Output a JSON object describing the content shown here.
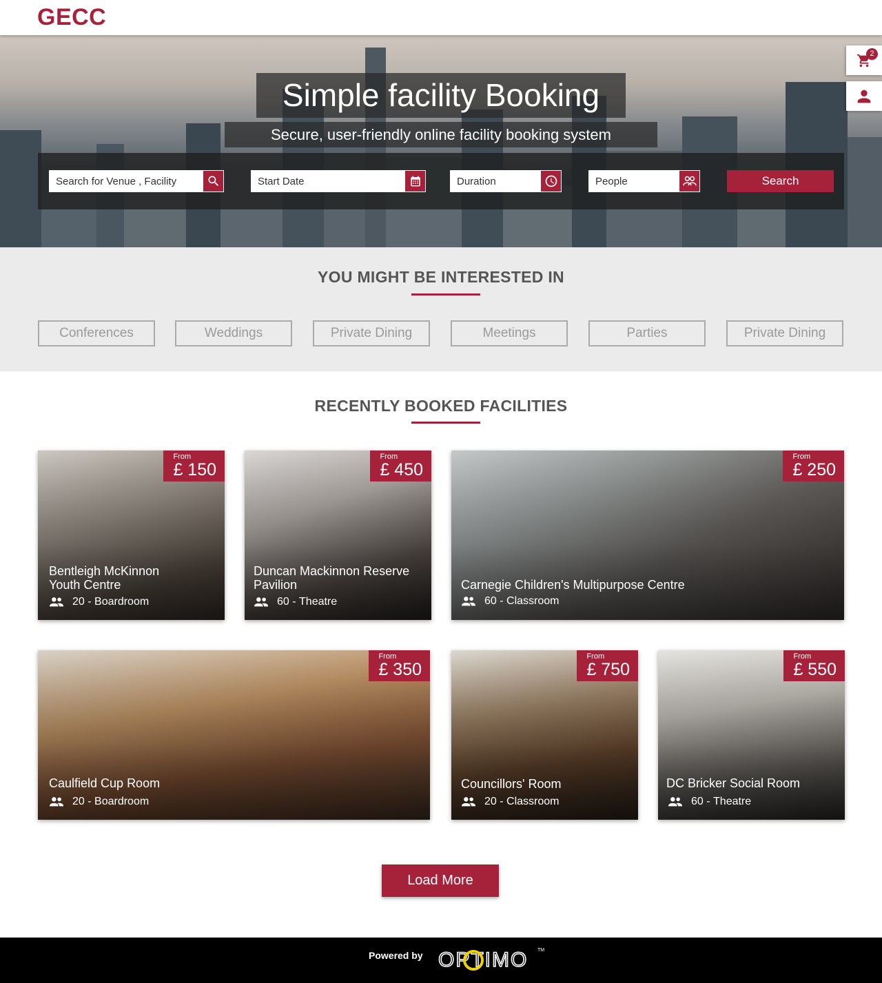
{
  "header": {
    "logo": "GECC"
  },
  "hero": {
    "title": "Simple facility Booking",
    "subtitle": "Secure, user-friendly online facility booking system",
    "search": {
      "venue_placeholder": "Search for Venue , Facility",
      "date_placeholder": "Start Date",
      "duration_placeholder": "Duration",
      "people_placeholder": "People",
      "button_label": "Search"
    }
  },
  "side": {
    "cart_count": "2"
  },
  "interest": {
    "title": "YOU MIGHT BE INTERESTED IN",
    "categories": [
      "Conferences",
      "Weddings",
      "Private Dining",
      "Meetings",
      "Parties",
      "Private Dining"
    ]
  },
  "recent": {
    "title": "RECENTLY BOOKED FACILITIES",
    "from_label": "From",
    "cards": [
      {
        "name": "Bentleigh McKinnon Youth Centre",
        "capacity": "20",
        "layout": "Boardroom",
        "price": "£ 150"
      },
      {
        "name": "Duncan Mackinnon Reserve Pavilion",
        "capacity": "60",
        "layout": "Theatre",
        "price": "£ 450"
      },
      {
        "name": "Carnegie Children's Multipurpose Centre",
        "capacity": "60",
        "layout": "Classroom",
        "price": "£ 250"
      },
      {
        "name": "Caulfield Cup Room",
        "capacity": "20",
        "layout": "Boardroom",
        "price": "£ 350"
      },
      {
        "name": "Councillors' Room",
        "capacity": "20",
        "layout": "Classroom",
        "price": "£ 750"
      },
      {
        "name": "DC Bricker Social Room",
        "capacity": "60",
        "layout": "Theatre",
        "price": "£ 550"
      }
    ],
    "load_more": "Load More"
  },
  "footer": {
    "powered_by": "Powered by",
    "brand": "OPTIMO",
    "trademark": "TM"
  },
  "colors": {
    "accent": "#a6213a",
    "section_bg": "#ebebeb",
    "footer_bg": "#000000"
  },
  "icons": [
    "search-icon",
    "calendar-icon",
    "clock-icon",
    "people-icon",
    "cart-icon",
    "user-icon"
  ]
}
